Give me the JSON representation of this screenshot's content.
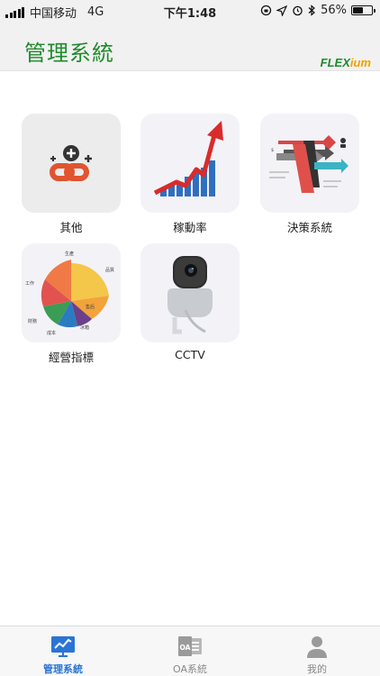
{
  "status_bar": {
    "carrier": "中国移动",
    "network": "4G",
    "time": "下午1:48",
    "battery_percent": "56%",
    "battery_level": 0.56
  },
  "header": {
    "title": "管理系統",
    "brand_prefix": "FLEX",
    "brand_suffix": "ium",
    "brand_colors": {
      "flex": "#1f8a2c",
      "ium": "#f2a000"
    }
  },
  "grid": {
    "items": [
      {
        "label": "其他",
        "icon": "link-add-icon"
      },
      {
        "label": "稼動率",
        "icon": "growth-chart-icon"
      },
      {
        "label": "決策系統",
        "icon": "decision-arrows-icon"
      },
      {
        "label": "經營指標",
        "icon": "pie-chart-icon"
      },
      {
        "label": "CCTV",
        "icon": "camera-icon"
      }
    ],
    "pie_labels": [
      "生產",
      "品質",
      "售后",
      "冰箱",
      "成本",
      "財務",
      "工作"
    ]
  },
  "tabbar": {
    "tabs": [
      {
        "label": "管理系統",
        "icon": "monitor-chart-icon",
        "active": true
      },
      {
        "label": "OA系統",
        "icon": "outlook-icon",
        "active": false
      },
      {
        "label": "我的",
        "icon": "person-icon",
        "active": false
      }
    ],
    "active_color": "#2a74d6",
    "inactive_color": "#888888"
  }
}
